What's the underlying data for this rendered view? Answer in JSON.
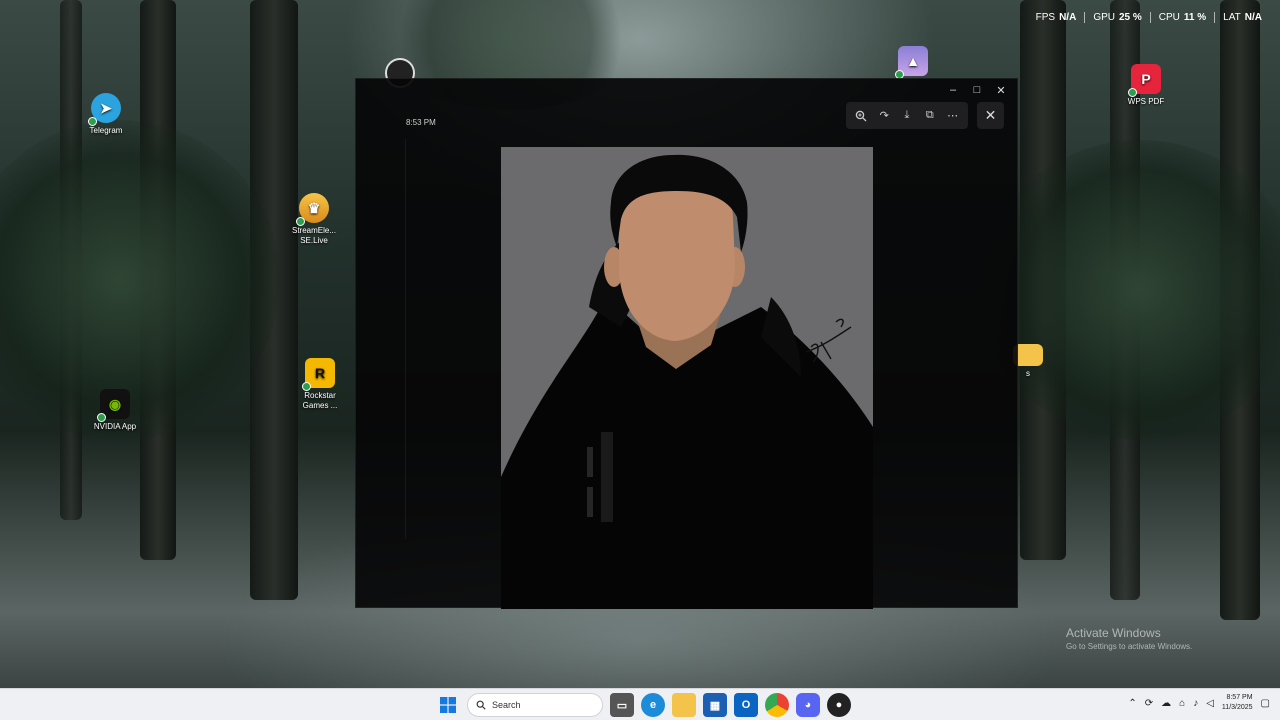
{
  "stats": [
    {
      "label": "FPS",
      "value": "N/A"
    },
    {
      "label": "GPU",
      "value": "25 %"
    },
    {
      "label": "CPU",
      "value": "11 %"
    },
    {
      "label": "LAT",
      "value": "N/A"
    }
  ],
  "desktop_icons": {
    "telegram": "Telegram",
    "streamelements_1": "StreamEle...",
    "streamelements_2": "SE.Live",
    "rockstar_1": "Rockstar",
    "rockstar_2": "Games ...",
    "nvidia": "NVIDIA App",
    "wps": "WPS PDF",
    "folder": "s"
  },
  "viewer": {
    "timestamp": "8:53 PM",
    "zoom_icon": "zoom-in-icon",
    "rotate_icon": "rotate-icon",
    "download_icon": "download-icon",
    "open_icon": "open-external-icon",
    "more_icon": "more-icon",
    "close_icon": "close-icon",
    "signature": "signature"
  },
  "taskbar": {
    "search_placeholder": "Search",
    "clock_time": "8:57 PM",
    "clock_date": "11/3/2025"
  },
  "watermark": {
    "line1": "Activate Windows",
    "line2": "Go to Settings to activate Windows."
  }
}
